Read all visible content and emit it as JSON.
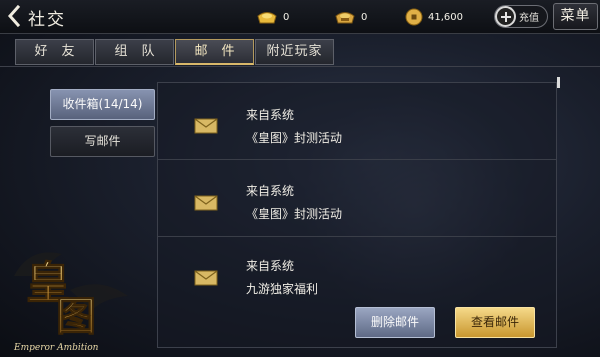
{
  "header": {
    "title": "社交",
    "gold_ingot": "0",
    "bound_ingot": "0",
    "coins": "41,600",
    "recharge_label": "充值",
    "menu_label": "菜单"
  },
  "tabs": [
    {
      "label": "好友",
      "active": false
    },
    {
      "label": "组队",
      "active": false
    },
    {
      "label": "邮件",
      "active": true
    },
    {
      "label": "附近玩家",
      "active": false
    }
  ],
  "sidebar": {
    "inbox_label": "收件箱(14/14)",
    "compose_label": "写邮件"
  },
  "mails": [
    {
      "sender": "来自系统",
      "subject": "《皇图》封测活动"
    },
    {
      "sender": "来自系统",
      "subject": "《皇图》封测活动"
    },
    {
      "sender": "来自系统",
      "subject": "九游独家福利"
    }
  ],
  "actions": {
    "delete_label": "删除邮件",
    "view_label": "查看邮件"
  },
  "logo": {
    "title_lines": [
      "皇",
      "图"
    ],
    "subtitle": "Emperor Ambition"
  },
  "colors": {
    "accent_gold": "#d9b86a",
    "inbox_blue": "#8793b0",
    "view_button": "#e9c46a",
    "icons_envelope": "#d8b864"
  }
}
